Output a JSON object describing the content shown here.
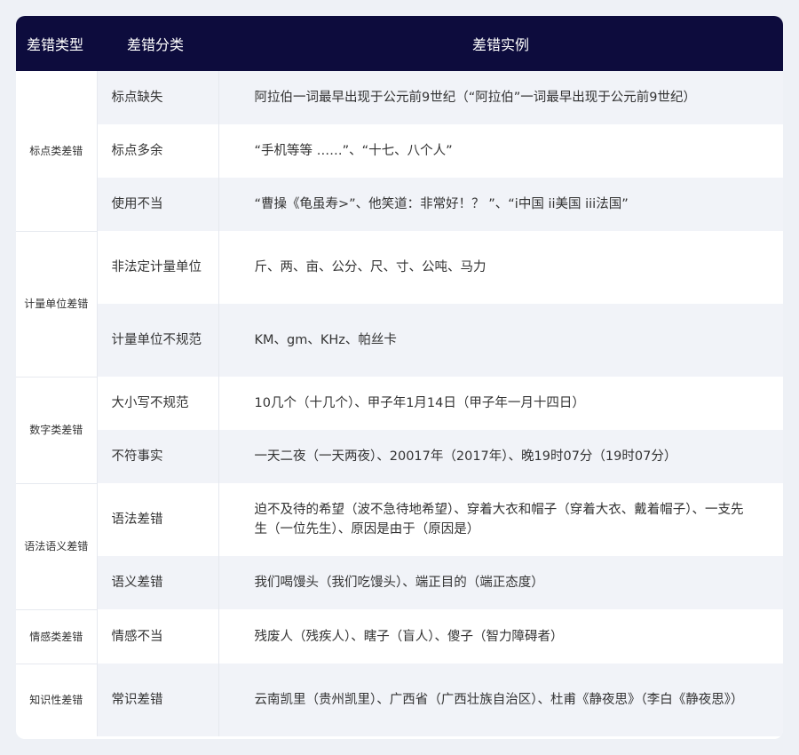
{
  "header": {
    "col_type": "差错类型",
    "col_category": "差错分类",
    "col_example": "差错实例"
  },
  "groups": [
    {
      "type": "标点类差错",
      "rows": [
        {
          "category": "标点缺失",
          "example": "阿拉伯一词最早出现于公元前9世纪（“阿拉伯”一词最早出现于公元前9世纪）"
        },
        {
          "category": "标点多余",
          "example": "“手机等等 ……”、“十七、八个人”"
        },
        {
          "category": "使用不当",
          "example": "“曹操《龟虽寿>”、他笑道：非常好！？ ”、“i中国 ii美国 iii法国”"
        }
      ]
    },
    {
      "type": "计量单位差错",
      "rows": [
        {
          "category": "非法定计量单位",
          "example": "斤、两、亩、公分、尺、寸、公吨、马力"
        },
        {
          "category": "计量单位不规范",
          "example": "KM、gm、KHz、帕丝卡"
        }
      ]
    },
    {
      "type": "数字类差错",
      "rows": [
        {
          "category": "大小写不规范",
          "example": "10几个（十几个）、甲子年1月14日（甲子年一月十四日）"
        },
        {
          "category": "不符事实",
          "example": "一天二夜（一天两夜）、20017年（2017年）、晚19时07分（19时07分）"
        }
      ]
    },
    {
      "type": "语法语义差错",
      "rows": [
        {
          "category": "语法差错",
          "example": "迫不及待的希望（波不急待地希望）、穿着大衣和帽子（穿着大衣、戴着帽子）、一支先生（一位先生）、原因是由于（原因是）"
        },
        {
          "category": "语义差错",
          "example": "我们喝馒头（我们吃馒头）、端正目的（端正态度）"
        }
      ]
    },
    {
      "type": "情感类差错",
      "rows": [
        {
          "category": "情感不当",
          "example": "残废人（残疾人）、瞎子（盲人）、傻子（智力障碍者）"
        }
      ]
    },
    {
      "type": "知识性差错",
      "rows": [
        {
          "category": "常识差错",
          "example": "云南凯里（贵州凯里）、广西省（广西壮族自治区）、杜甫《静夜思》（李白《静夜思》）"
        }
      ]
    }
  ]
}
